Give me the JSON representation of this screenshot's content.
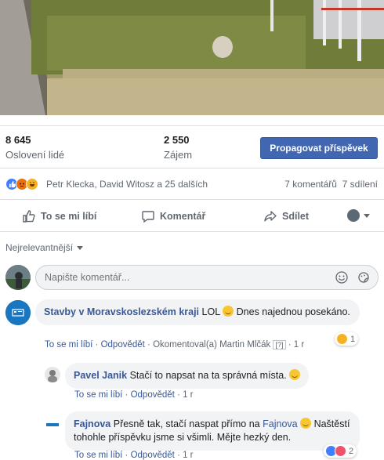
{
  "stats": {
    "reach_value": "8 645",
    "reach_label": "Oslovení lidé",
    "engagement_value": "2 550",
    "engagement_label": "Zájem",
    "promote_label": "Propagovat příspěvek"
  },
  "reactions": {
    "names": "Petr Klecka, David Witosz a 25 dalších",
    "counts": "7 komentářů  7 sdílení",
    "icons": [
      "like",
      "angry",
      "haha"
    ]
  },
  "actions": {
    "like": "To se mi líbí",
    "comment": "Komentář",
    "share": "Sdílet"
  },
  "sort_label": "Nejrelevantnější",
  "composer": {
    "placeholder": "Napište komentář..."
  },
  "comments": [
    {
      "author": "Stavby v Moravskoslezském kraji",
      "text_a": "LOL",
      "text_b": "Dnes najednou posekáno.",
      "like": "To se mi líbí",
      "reply": "Odpovědět",
      "commented_by": "Okomentoval(a) Martin Mlčák",
      "time": "1 r",
      "reaction_count": "1"
    },
    {
      "author": "Pavel Janik",
      "text": "Stačí to napsat na ta správná místa.",
      "like": "To se mi líbí",
      "reply": "Odpovědět",
      "time": "1 r"
    },
    {
      "author": "Fajnova",
      "text_a": "Přesně tak, stačí naspat přímo na",
      "mention": "Fajnova",
      "text_b": "Naštěstí tohohle příspěvku jsme si všimli. Mějte hezký den.",
      "like": "To se mi líbí",
      "reply": "Odpovědět",
      "time": "1 r",
      "reaction_count": "2"
    }
  ],
  "colors": {
    "accent": "#4267b2",
    "link": "#385898",
    "bubble": "#f2f3f5",
    "muted": "#606770"
  }
}
